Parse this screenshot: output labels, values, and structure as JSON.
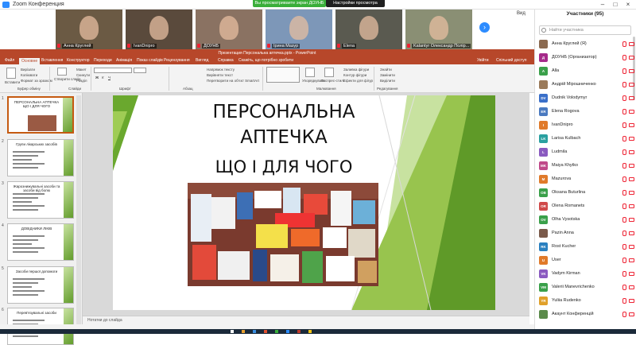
{
  "zoom": {
    "window_title": "Zoom Конференция",
    "share_banner": "Вы просматриваете экран ДОУНБ",
    "view_options": "Настройки просмотра",
    "view_label": "Вид"
  },
  "video_tiles": [
    {
      "name": "Анна Круглей",
      "bg": "#6b5a44"
    },
    {
      "name": "IvanDnipro",
      "bg": "#5a4a3c"
    },
    {
      "name": "ДОУНБ",
      "bg": "#8a7262"
    },
    {
      "name": "Ірина Мазур",
      "bg": "#7d97b8"
    },
    {
      "name": "Elena",
      "bg": "#5a5a50"
    },
    {
      "name": "Kalantyr Олександр Полiр...",
      "bg": "#8a8f74"
    }
  ],
  "ppt": {
    "window_title": "Презентация Персональна аптечка.pptx - PowerPoint",
    "tabs": [
      "Файл",
      "Основне",
      "Вставлення",
      "Конструктор",
      "Переходи",
      "Анімація",
      "Показ слайдів",
      "Рецензування",
      "Вигляд",
      "Справка",
      "Скажіть, що потрібно зробити"
    ],
    "tab_right": [
      "Увійти",
      "Спільний доступ"
    ],
    "ribbon": {
      "paste": "Вставити",
      "cut": "Вирізати",
      "copy": "Копіювати",
      "format_painter": "Формат за зразком",
      "clipboard": "Буфер обміну",
      "new_slide": "Створити слайд",
      "layout": "Макет",
      "reset": "Скинути",
      "section": "Розділ",
      "slides": "Слайди",
      "font": "Шрифт",
      "paragraph": "Абзац",
      "text_direction": "Напрямок тексту",
      "align_text": "Вирівняти текст",
      "smartart": "Перетворити на об'єкт SmartArt",
      "arrange": "Упорядкувати",
      "quick_styles": "Експрес-стилі",
      "shape_fill": "Заливка фігури",
      "shape_outline": "Контур фігури",
      "shape_effects": "Ефекти для фігур",
      "drawing": "Малювання",
      "find": "Знайти",
      "replace": "Замінити",
      "select": "Виділити",
      "editing": "Редагування"
    },
    "slide_numbers": [
      "1",
      "2",
      "3",
      "4",
      "5",
      "6"
    ],
    "thumb_titles": [
      "ПЕРСОНАЛЬНА АПТЕЧКА ЩО І ДЛЯ ЧОГО",
      "Групи лікарських засобів",
      "Жарознижувальні засоби та засоби від болю",
      "ДОВІДНИКИ ЛІКІВ",
      "Засоби першої допомоги",
      "Перев'язувальні засоби"
    ],
    "slide": {
      "title_line1": "ПЕРСОНАЛЬНА",
      "title_line2": "АПТЕЧКА",
      "title_line3": "ЩО І ДЛЯ ЧОГО"
    },
    "notes_placeholder": "Нотатки до слайда"
  },
  "participants": {
    "header": "Участники (95)",
    "search_placeholder": "Найти участника",
    "list": [
      {
        "initials": "",
        "name": "Анна Круглей (Я)",
        "color": "#8b6a50"
      },
      {
        "initials": "Д",
        "name": "ДОУНБ (Организатор)",
        "color": "#a52a8a"
      },
      {
        "initials": "A",
        "name": "Alla",
        "color": "#3aa04a"
      },
      {
        "initials": "",
        "name": "Андрій Мірошниченко",
        "color": "#9a7a5a"
      },
      {
        "initials": "DV",
        "name": "Dudnik Volodymyr",
        "color": "#3a6fc9"
      },
      {
        "initials": "ER",
        "name": "Elena Rogova",
        "color": "#4a7ac0"
      },
      {
        "initials": "I",
        "name": "IvanDnipro",
        "color": "#e07a2a"
      },
      {
        "initials": "LK",
        "name": "Larisa Kulbach",
        "color": "#2aa0a0"
      },
      {
        "initials": "L",
        "name": "Ludmila",
        "color": "#8a5ac0"
      },
      {
        "initials": "MK",
        "name": "Maiya Khytko",
        "color": "#c04a8a"
      },
      {
        "initials": "M",
        "name": "Mazurova",
        "color": "#e07a2a"
      },
      {
        "initials": "OB",
        "name": "Oksana Buturlina",
        "color": "#3aa04a"
      },
      {
        "initials": "OR",
        "name": "Olena Romanets",
        "color": "#d04a4a"
      },
      {
        "initials": "OV",
        "name": "Olha Vysotska",
        "color": "#3aa04a"
      },
      {
        "initials": "",
        "name": "Pazin Anna",
        "color": "#7a5a4a"
      },
      {
        "initials": "RK",
        "name": "Rost Kucher",
        "color": "#2a80c0"
      },
      {
        "initials": "U",
        "name": "User",
        "color": "#e07a2a"
      },
      {
        "initials": "VK",
        "name": "Vadym Kirman",
        "color": "#8a5ac0"
      },
      {
        "initials": "VM",
        "name": "Valerii Manevrichenko",
        "color": "#3aa04a"
      },
      {
        "initials": "YR",
        "name": "Yuliia Rudenko",
        "color": "#e0a02a"
      },
      {
        "initials": "",
        "name": "Акаунт Конференцій",
        "color": "#5a8a4a"
      }
    ]
  }
}
